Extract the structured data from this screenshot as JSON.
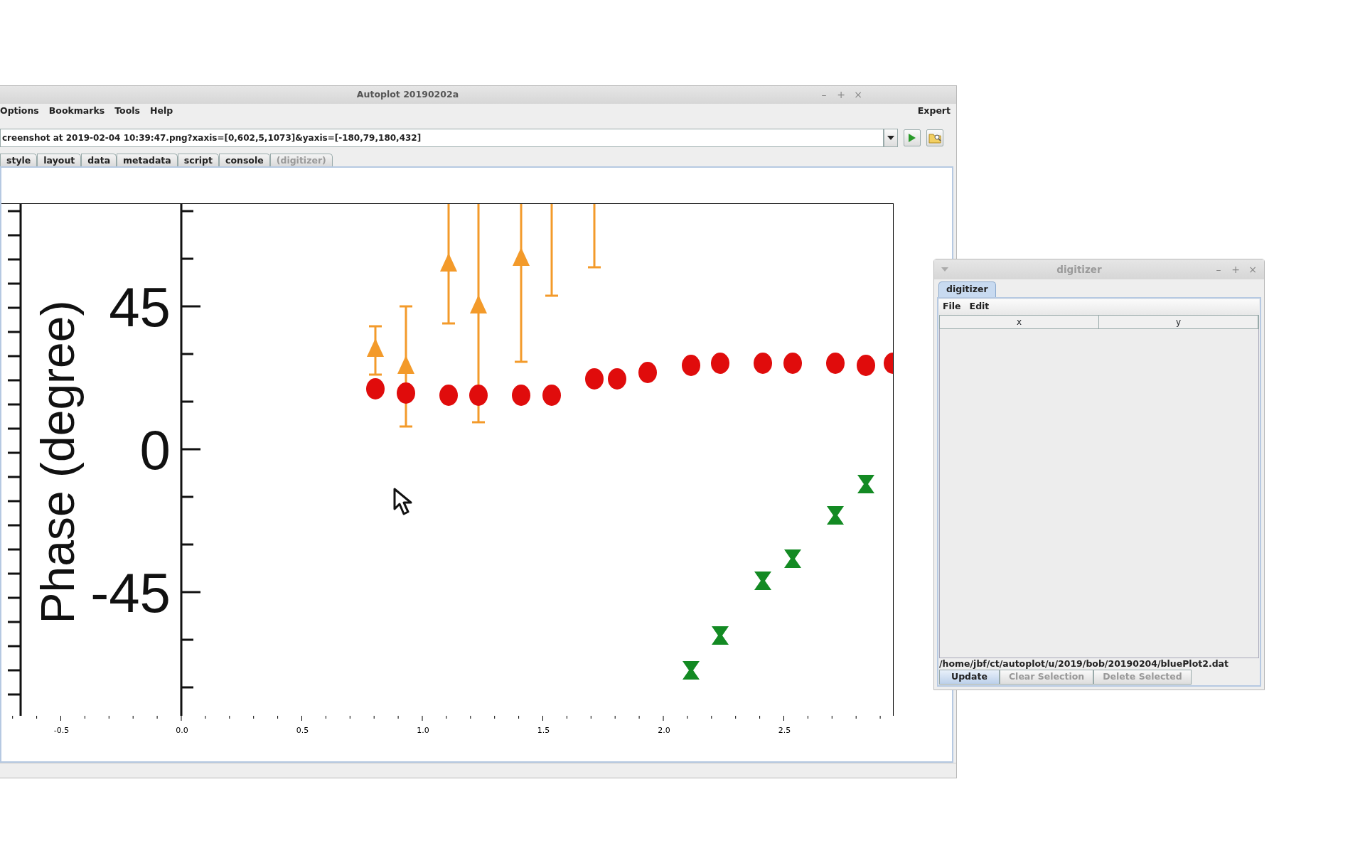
{
  "main_window": {
    "title": "Autoplot 20190202a",
    "controls": [
      "–",
      "+",
      "×"
    ]
  },
  "menus": [
    "Options",
    "Bookmarks",
    "Tools",
    "Help"
  ],
  "mode_label": "Expert",
  "address": {
    "value": "creenshot at 2019-02-04 10:39:47.png?xaxis=[0,602,5,1073]&yaxis=[-180,79,180,432]"
  },
  "tabs": [
    {
      "label": "style",
      "selected": false,
      "disabled": false
    },
    {
      "label": "layout",
      "selected": false,
      "disabled": false
    },
    {
      "label": "data",
      "selected": false,
      "disabled": false
    },
    {
      "label": "metadata",
      "selected": false,
      "disabled": false
    },
    {
      "label": "script",
      "selected": false,
      "disabled": false
    },
    {
      "label": "console",
      "selected": false,
      "disabled": false
    },
    {
      "label": "(digitizer)",
      "selected": false,
      "disabled": true
    }
  ],
  "plot_image": {
    "y_label": "Phase (degree)",
    "y_tick_labels": [
      "45",
      "0",
      "-45"
    ]
  },
  "x_axis": {
    "tick_labels": [
      "-0.5",
      "0.0",
      "0.5",
      "1.0",
      "1.5",
      "2.0",
      "2.5"
    ]
  },
  "digitizer_window": {
    "title": "digitizer",
    "active": false,
    "controls": [
      "–",
      "+",
      "×"
    ],
    "tabs": [
      {
        "label": "digitizer",
        "selected": true
      }
    ],
    "menus": [
      "File",
      "Edit"
    ],
    "table": {
      "columns": [
        "x",
        "y"
      ]
    },
    "file_path": "/home/jbf/ct/autoplot/u/2019/bob/20190204/bluePlot2.dat",
    "buttons": [
      {
        "label": "Update",
        "disabled": false
      },
      {
        "label": "Clear Selection",
        "disabled": true
      },
      {
        "label": "Delete Selected",
        "disabled": true
      }
    ]
  }
}
